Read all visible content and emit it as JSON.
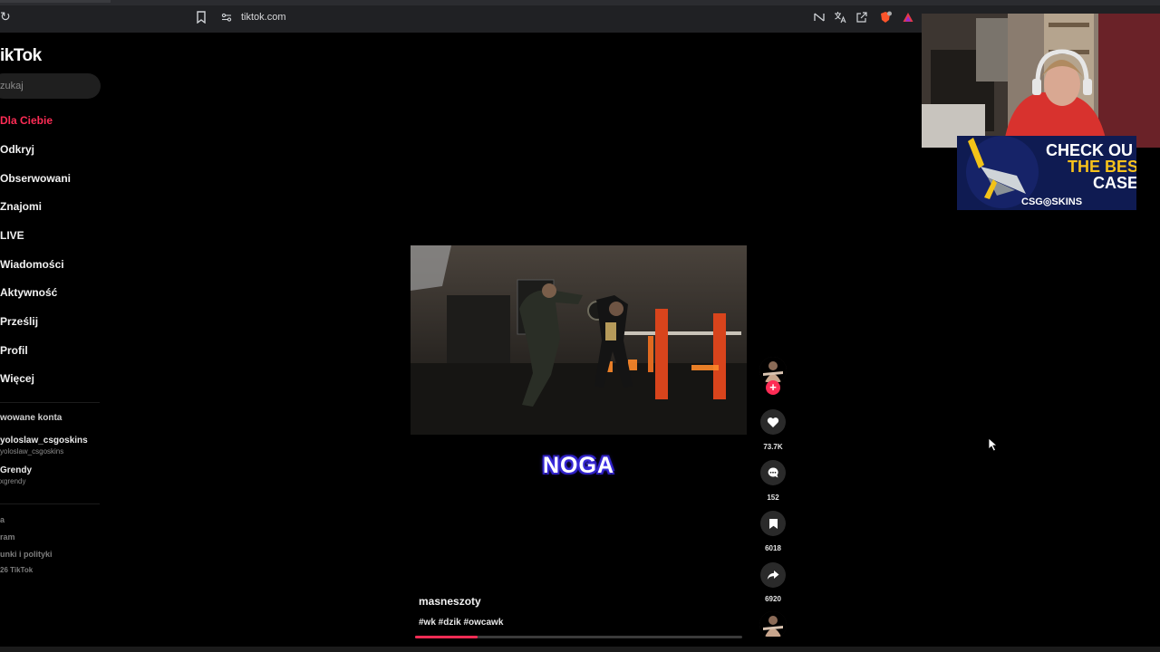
{
  "browser": {
    "url": "tiktok.com"
  },
  "sidebar": {
    "logo": "ikTok",
    "search_placeholder": "zukaj",
    "nav": [
      {
        "label": "Dla Ciebie",
        "active": true
      },
      {
        "label": "Odkryj"
      },
      {
        "label": "Obserwowani"
      },
      {
        "label": "Znajomi"
      },
      {
        "label": "LIVE"
      },
      {
        "label": "Wiadomości"
      },
      {
        "label": "Aktywność"
      },
      {
        "label": "Prześlij"
      },
      {
        "label": "Profil"
      },
      {
        "label": "Więcej"
      }
    ],
    "followed_title": "wowane konta",
    "accounts": [
      {
        "name": "yoloslaw_csgoskins",
        "handle": "yoloslaw_csgoskins"
      },
      {
        "name": "Grendy",
        "handle": "xgrendy"
      }
    ],
    "footer": [
      "a",
      "ram",
      "unki i polityki",
      "26 TikTok"
    ]
  },
  "video": {
    "caption": "NOGA",
    "author": "masneszoty",
    "hashtags": "#wk #dzik #owcawk",
    "progress": 0.19
  },
  "actions": {
    "likes": "73.7K",
    "comments": "152",
    "saves": "6018",
    "shares": "6920"
  },
  "overlay": {
    "ad_line1": "CHECK OU",
    "ad_line2": "THE BES",
    "ad_line3": "CASE",
    "ad_brand": "CSG◎SKINS"
  },
  "colors": {
    "accent": "#fe2c55",
    "background": "#000000"
  }
}
